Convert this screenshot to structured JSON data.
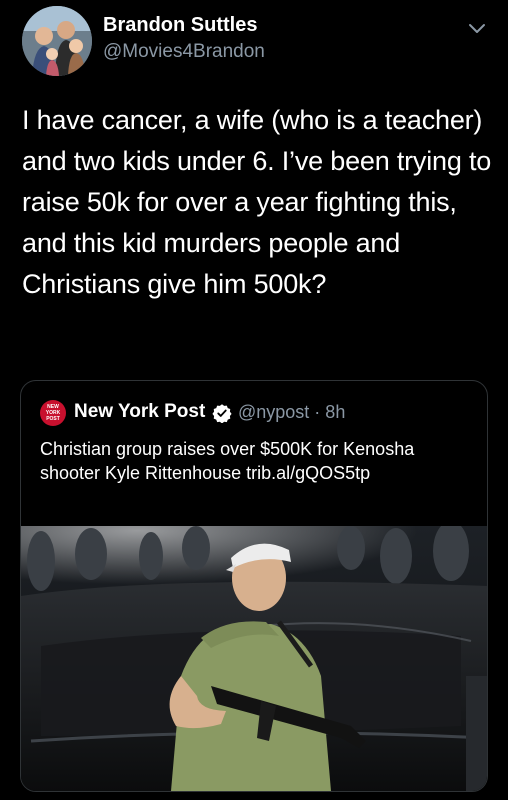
{
  "author": {
    "name": "Brandon Suttles",
    "handle": "@Movies4Brandon"
  },
  "tweet": {
    "text": "I have cancer, a wife (who is a teacher) and two kids under 6. I’ve been trying to raise 50k for over a year fighting this, and this kid murders people and Christians give him 500k?"
  },
  "quoted": {
    "logo_text": "NEW YORK POST",
    "name": "New York Post",
    "handle_time": "@nypost · 8h",
    "text": "Christian group raises over $500K for Kenosha shooter Kyle Rittenhouse trib.al/gQOS5tp"
  },
  "colors": {
    "background": "#000000",
    "text": "#ffffff",
    "secondary": "#8b98a5",
    "verified": "#ffffff",
    "nypost_red": "#c8102e"
  },
  "icons": [
    "chevron-down-icon",
    "verified-badge-icon"
  ]
}
